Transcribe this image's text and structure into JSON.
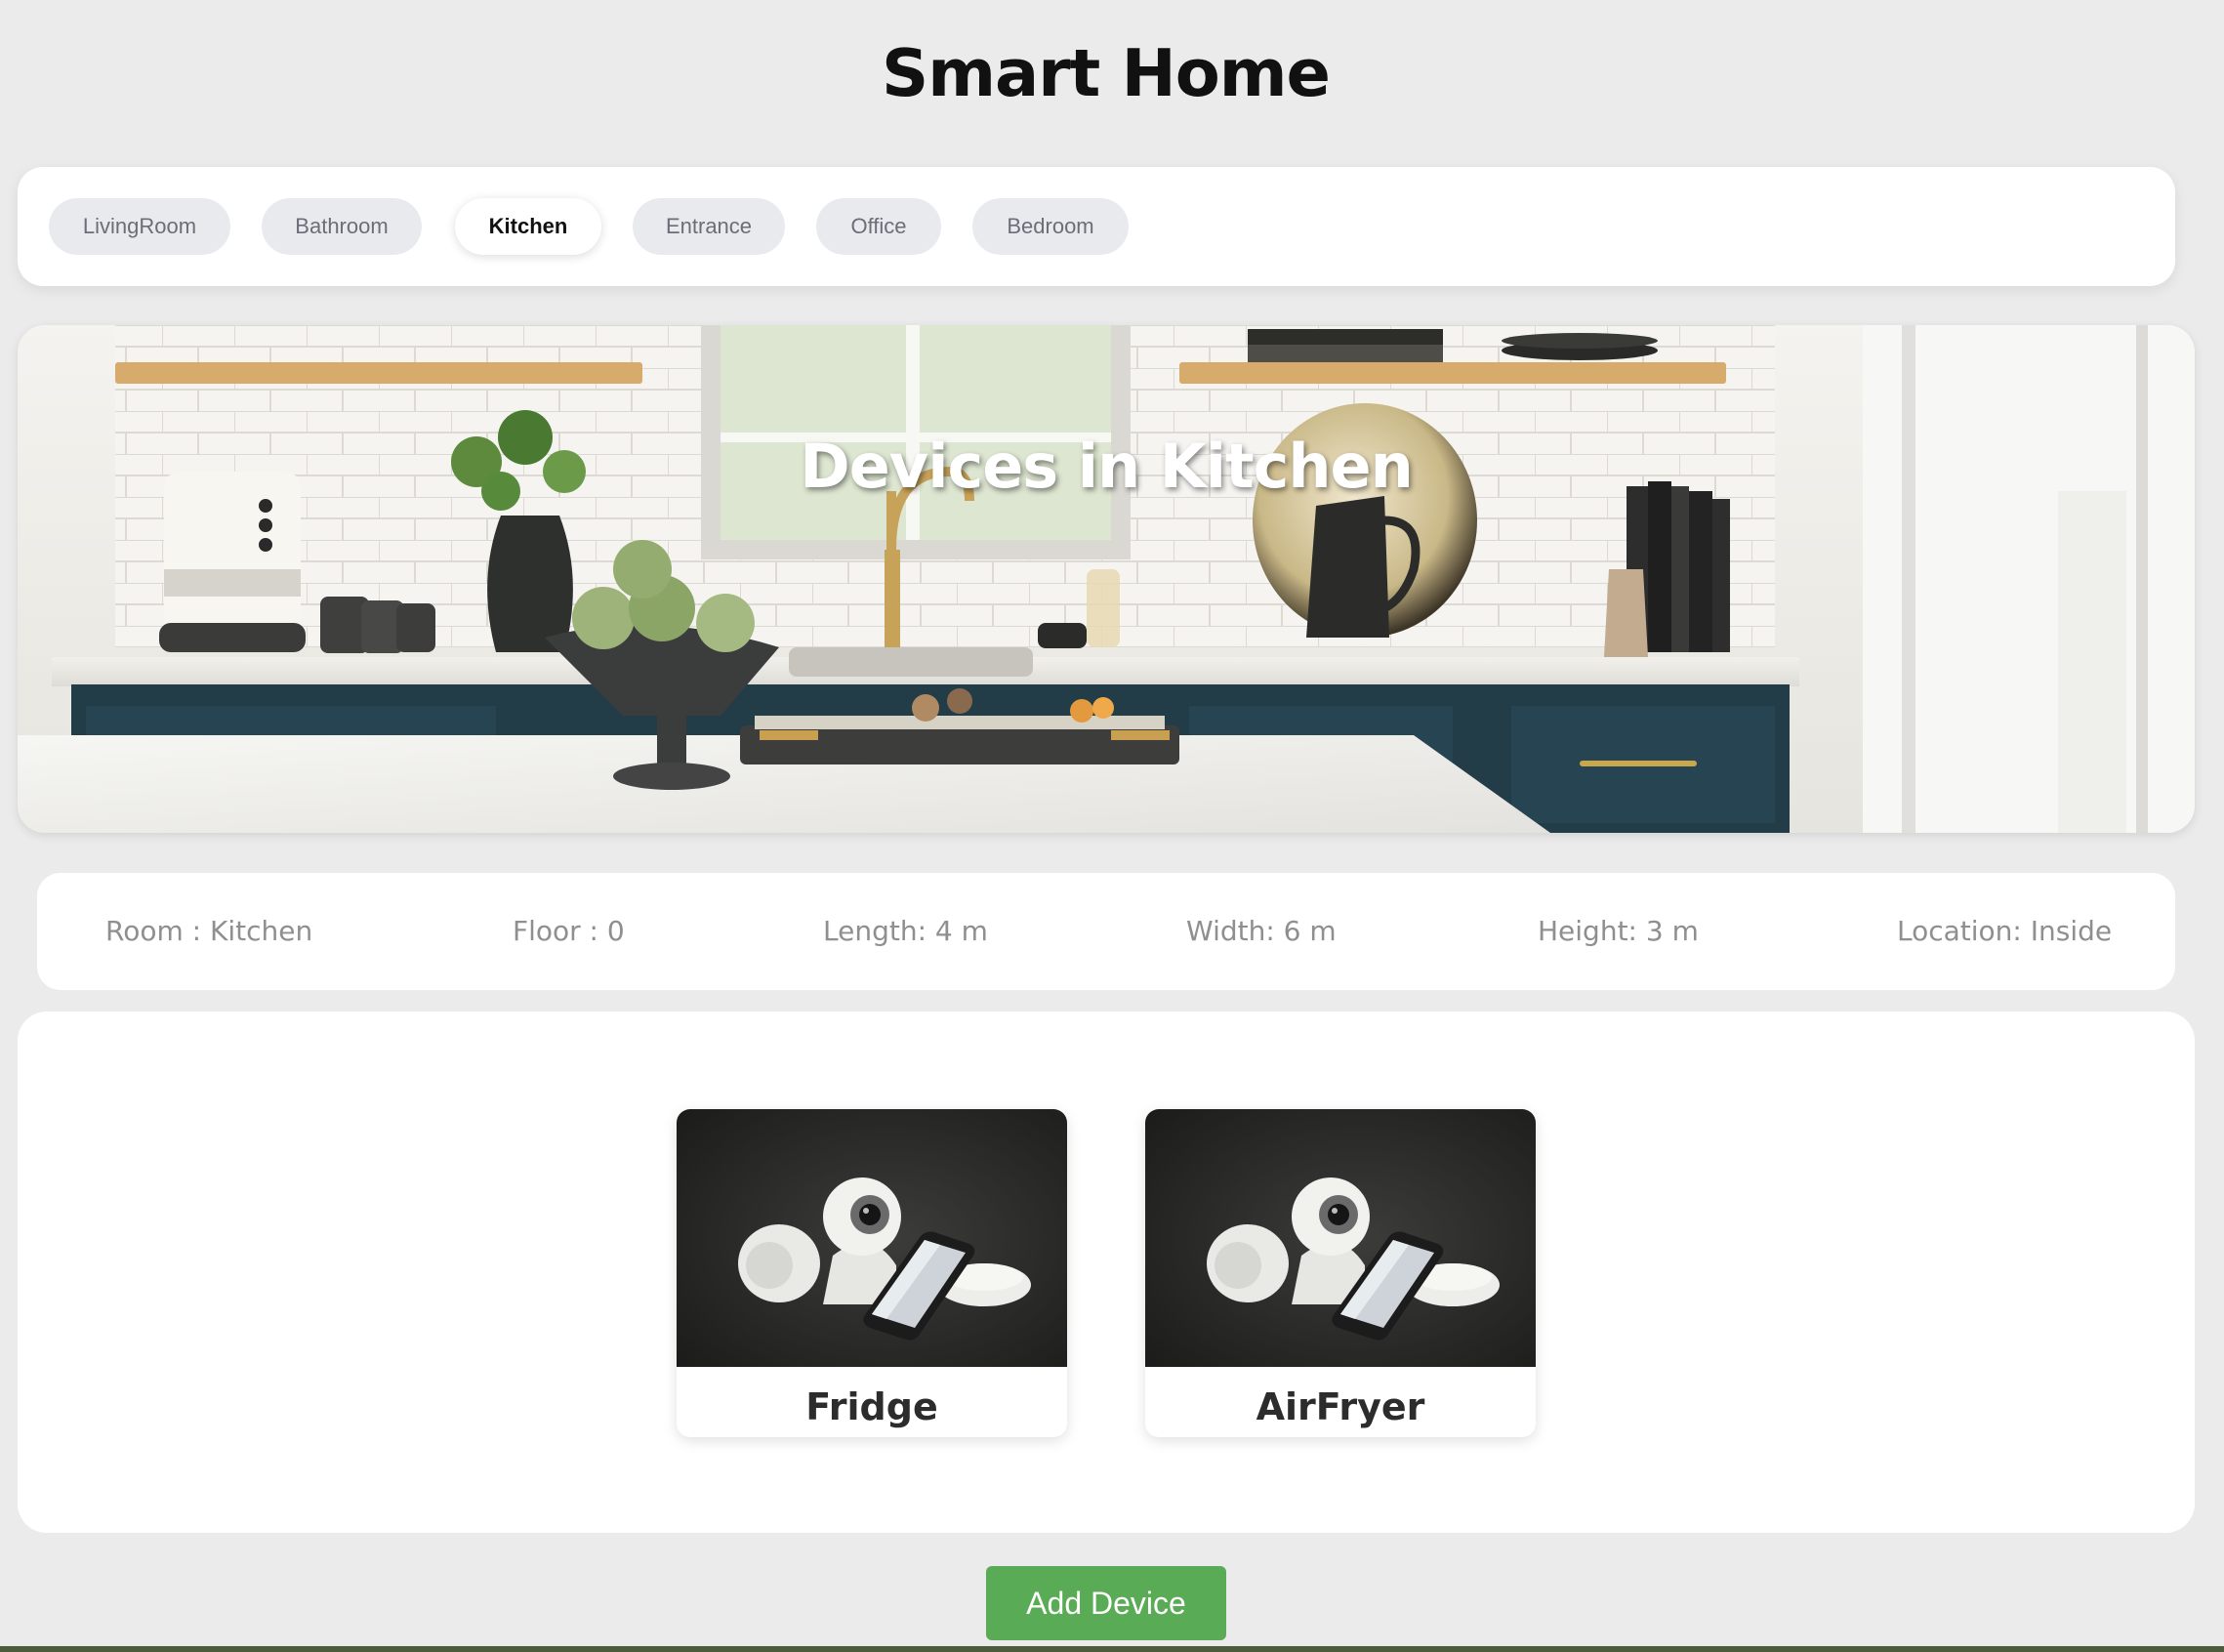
{
  "header": {
    "title": "Smart Home"
  },
  "rooms": {
    "tabs": [
      {
        "label": "LivingRoom",
        "active": false
      },
      {
        "label": "Bathroom",
        "active": false
      },
      {
        "label": "Kitchen",
        "active": true
      },
      {
        "label": "Entrance",
        "active": false
      },
      {
        "label": "Office",
        "active": false
      },
      {
        "label": "Bedroom",
        "active": false
      }
    ]
  },
  "hero": {
    "title": "Devices in Kitchen"
  },
  "room_info": {
    "room": "Room : Kitchen",
    "floor": "Floor : 0",
    "length": "Length: 4 m",
    "width": "Width: 6 m",
    "height": "Height: 3 m",
    "location": "Location: Inside"
  },
  "devices": [
    {
      "name": "Fridge"
    },
    {
      "name": "AirFryer"
    }
  ],
  "actions": {
    "add_device_label": "Add Device"
  },
  "colors": {
    "background": "#ebebeb",
    "card": "#ffffff",
    "tab_inactive": "#e9eaee",
    "add_button": "#5aab55"
  }
}
